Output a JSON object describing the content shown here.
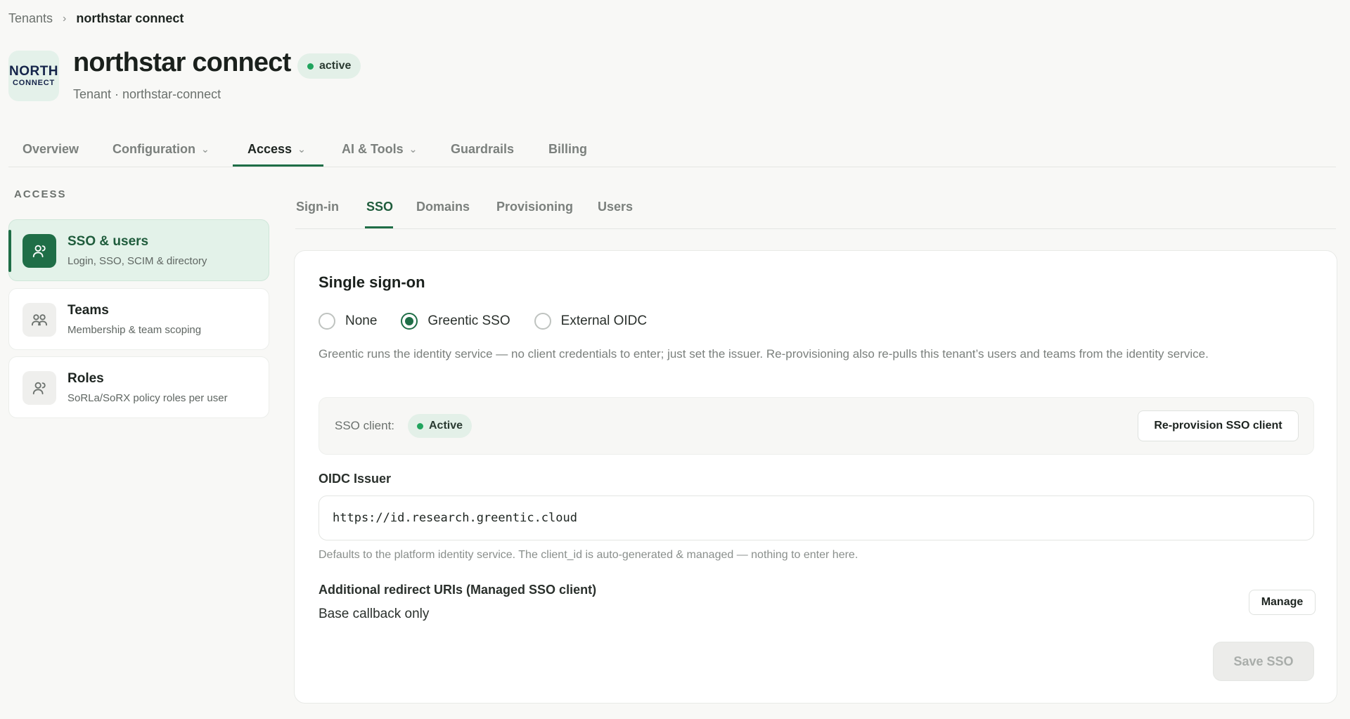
{
  "breadcrumb": {
    "parent": "Tenants",
    "separator": "›",
    "current": "northstar connect"
  },
  "tenant": {
    "logo_line1": "NORTH",
    "logo_line2": "CONNECT",
    "name": "northstar connect",
    "status": "active",
    "subtitle": "Tenant · northstar-connect"
  },
  "main_tabs": [
    {
      "label": "Overview",
      "has_dropdown": false
    },
    {
      "label": "Configuration",
      "has_dropdown": true
    },
    {
      "label": "Access",
      "has_dropdown": true,
      "active": true
    },
    {
      "label": "AI & Tools",
      "has_dropdown": true
    },
    {
      "label": "Guardrails",
      "has_dropdown": false
    },
    {
      "label": "Billing",
      "has_dropdown": false
    }
  ],
  "sidebar": {
    "section_label": "ACCESS",
    "items": [
      {
        "title": "SSO & users",
        "description": "Login, SSO, SCIM & directory",
        "icon": "user-icon",
        "active": true
      },
      {
        "title": "Teams",
        "description": "Membership & team scoping",
        "icon": "users-icon"
      },
      {
        "title": "Roles",
        "description": "SoRLa/SoRX policy roles per user",
        "icon": "user-roles-icon"
      }
    ]
  },
  "sub_tabs": [
    {
      "label": "Sign-in"
    },
    {
      "label": "SSO",
      "active": true
    },
    {
      "label": "Domains"
    },
    {
      "label": "Provisioning"
    },
    {
      "label": "Users"
    }
  ],
  "sso": {
    "title": "Single sign-on",
    "options": [
      {
        "label": "None",
        "selected": false
      },
      {
        "label": "Greentic SSO",
        "selected": true
      },
      {
        "label": "External OIDC",
        "selected": false
      }
    ],
    "help": "Greentic runs the identity service — no client credentials to enter; just set the issuer. Re-provisioning also re-pulls this tenant’s users and teams from the identity service.",
    "client_label": "SSO client:",
    "client_status": "Active",
    "reprovision_label": "Re-provision SSO client",
    "issuer_label": "OIDC Issuer",
    "issuer_value": "https://id.research.greentic.cloud",
    "issuer_help": "Defaults to the platform identity service. The client_id is auto-generated & managed — nothing to enter here.",
    "redirect_label": "Additional redirect URIs (Managed SSO client)",
    "redirect_value": "Base callback only",
    "manage_label": "Manage",
    "save_label": "Save SSO"
  },
  "colors": {
    "accent": "#1f6e47",
    "status_dot": "#21a45e",
    "pill_bg": "#e3f0e8",
    "active_card_bg": "#e3f2e9"
  }
}
